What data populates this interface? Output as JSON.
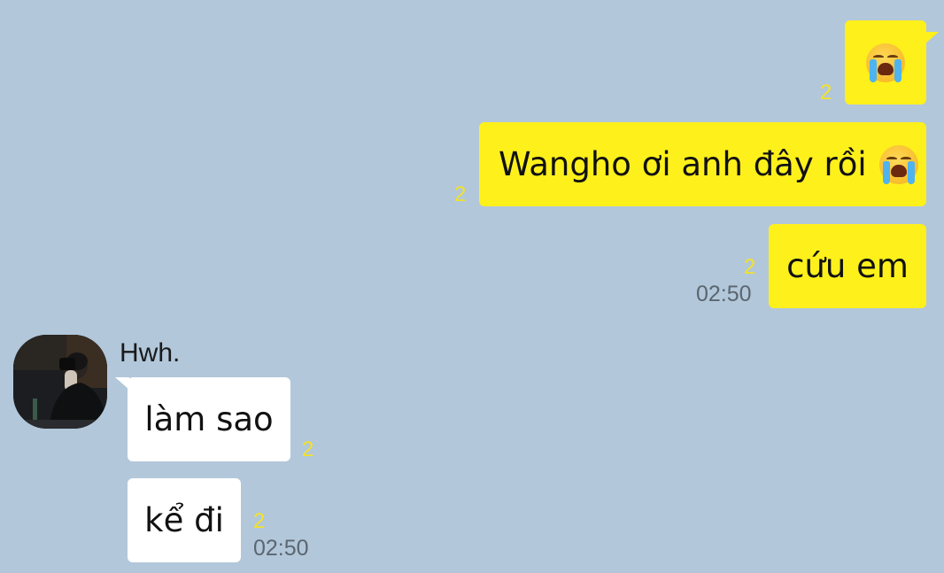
{
  "colors": {
    "background": "#b2c7da",
    "my_bubble": "#fef01b",
    "their_bubble": "#ffffff",
    "unread": "#f2e22a",
    "time": "#5b6670"
  },
  "messages": [
    {
      "sender": "me",
      "text": "",
      "emoji": "loudly-crying-face",
      "unread": "2",
      "time": ""
    },
    {
      "sender": "me",
      "text": "Wangho ơi anh đây rồi",
      "emoji": "loudly-crying-face",
      "unread": "2",
      "time": ""
    },
    {
      "sender": "me",
      "text": "cứu em",
      "emoji": "",
      "unread": "2",
      "time": "02:50"
    },
    {
      "sender": "them",
      "text": "làm sao",
      "emoji": "",
      "unread": "2",
      "time": ""
    },
    {
      "sender": "them",
      "text": "kể đi",
      "emoji": "",
      "unread": "2",
      "time": "02:50"
    }
  ],
  "contact": {
    "name": "Hwh.",
    "avatar_icon": "profile-photo"
  }
}
